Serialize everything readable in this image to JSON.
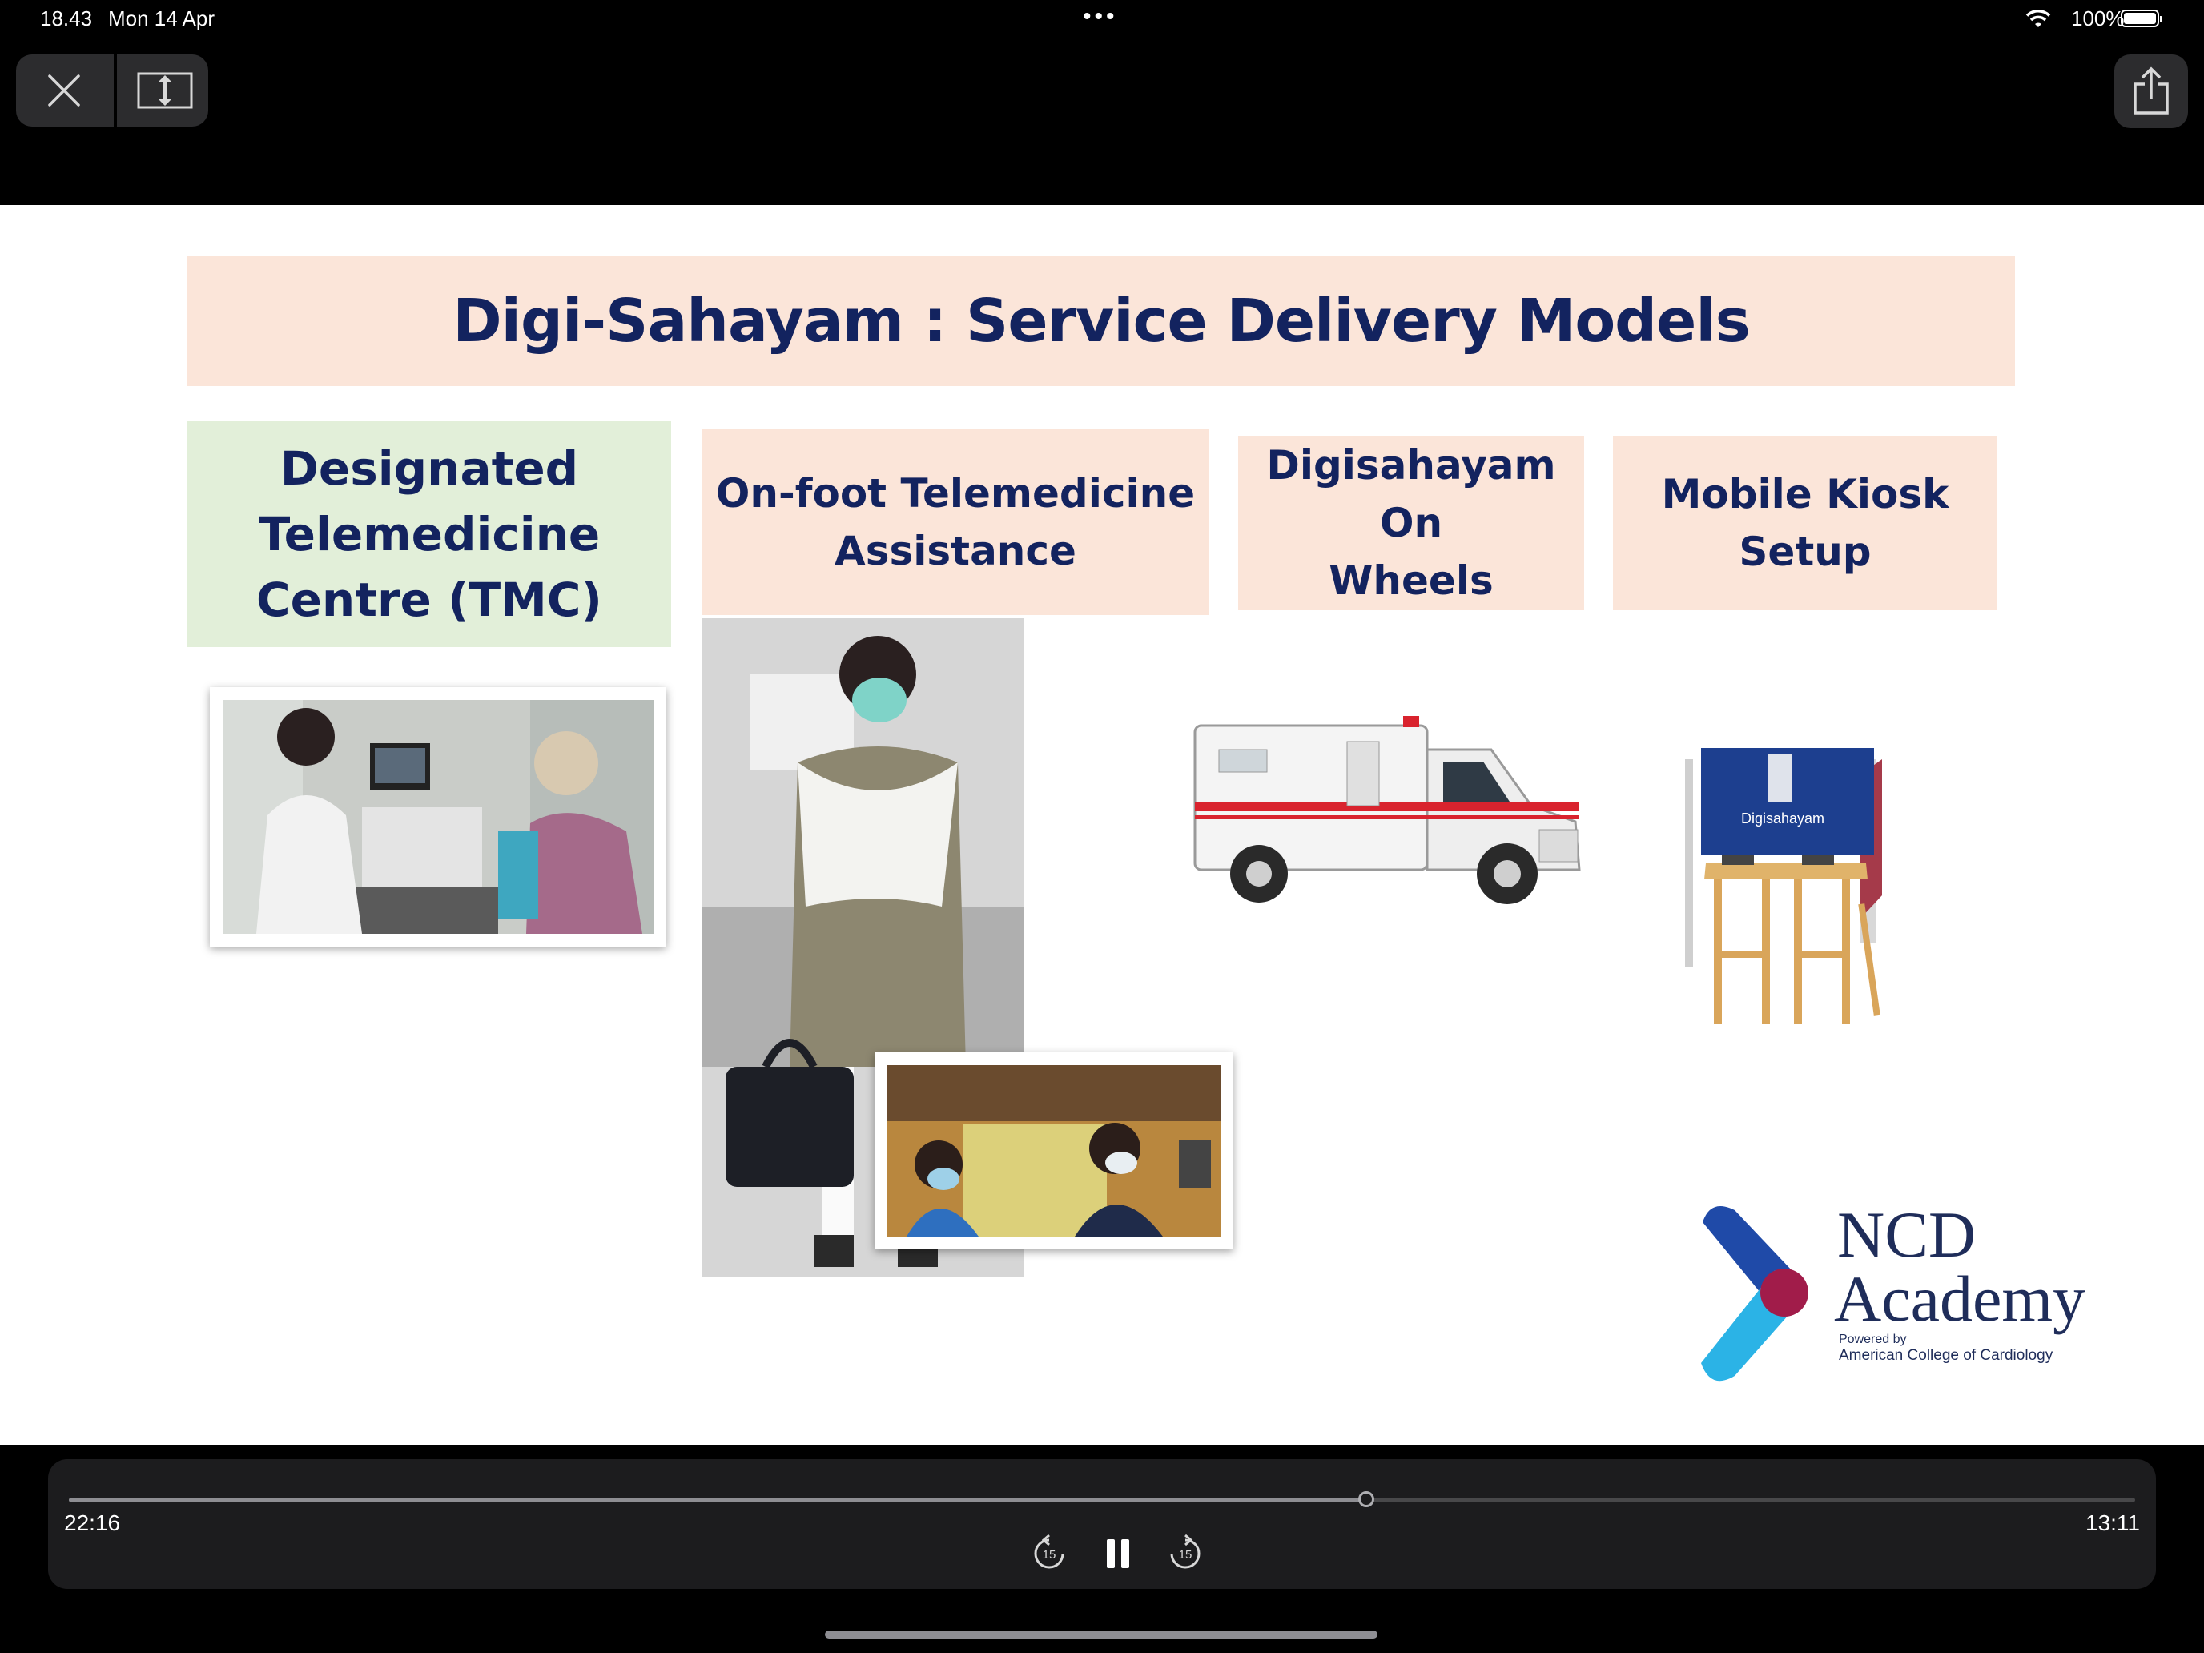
{
  "status_bar": {
    "time": "18.43",
    "date": "Mon 14 Apr",
    "battery": "100%"
  },
  "top_controls": {
    "close_icon": "close-icon",
    "resize_icon": "resize-vertical-icon",
    "share_icon": "share-icon"
  },
  "slide": {
    "title": "Digi-Sahayam : Service Delivery Models",
    "models": [
      {
        "label": "Designated\nTelemedicine\nCentre (TMC)",
        "color": "#e2efd9"
      },
      {
        "label": "On-foot Telemedicine\nAssistance",
        "color": "#fbe5d9"
      },
      {
        "label": "Digisahayam On\nWheels",
        "color": "#fbe5d9"
      },
      {
        "label": "Mobile Kiosk\nSetup",
        "color": "#fbe5d9"
      }
    ],
    "kiosk_sign": "Digisahayam",
    "logo": {
      "line1": "NCD",
      "line2": "Academy",
      "powered_by": "Powered by",
      "org": "American College of Cardiology"
    },
    "title_color": "#13235f"
  },
  "player": {
    "elapsed": "22:16",
    "remaining": "13:11",
    "progress": 0.628,
    "skip_back_label": "15",
    "skip_forward_label": "15",
    "state": "playing"
  }
}
